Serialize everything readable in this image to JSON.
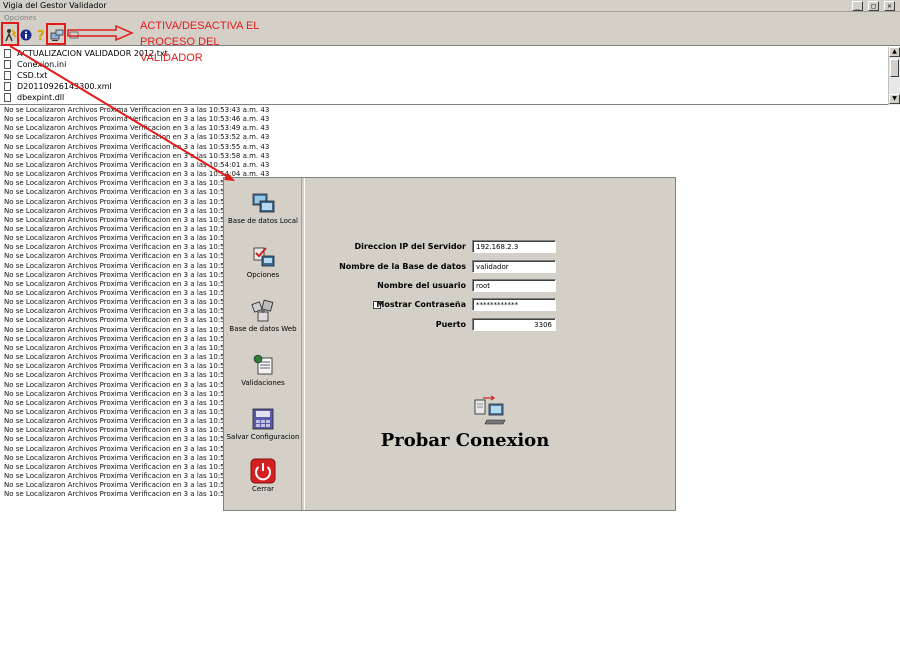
{
  "window": {
    "title": "Vigia del Gestor Validador",
    "min": "_",
    "max": "□",
    "close": "✕"
  },
  "menu": {
    "label": "Opciones"
  },
  "files": [
    "ACTUALIZACION VALIDADOR 2012.txt",
    "Conexion.ini",
    "CSD.txt",
    "D20110926143300.xml",
    "dbexpint.dll"
  ],
  "log_lines": [
    "No se Localizaron Archivos Proxima Verificacion en 3 a las 10:53:43 a.m.  43",
    "No se Localizaron Archivos Proxima Verificacion en 3 a las 10:53:46 a.m.  43",
    "No se Localizaron Archivos Proxima Verificacion en 3 a las 10:53:49 a.m.  43",
    "No se Localizaron Archivos Proxima Verificacion en 3 a las 10:53:52 a.m.  43",
    "No se Localizaron Archivos Proxima Verificacion en 3 a las 10:53:55 a.m.  43",
    "No se Localizaron Archivos Proxima Verificacion en 3 a las 10:53:58 a.m.  43",
    "No se Localizaron Archivos Proxima Verificacion en 3 a las 10:54:01 a.m.  43",
    "No se Localizaron Archivos Proxima Verificacion en 3 a las 10:54:04 a.m.  43",
    "No se Localizaron Archivos Proxima Verificacion en 3 a las 10:54:",
    "No se Localizaron Archivos Proxima Verificacion en 3 a las 10:54:",
    "No se Localizaron Archivos Proxima Verificacion en 3 a las 10:54:",
    "No se Localizaron Archivos Proxima Verificacion en 3 a las 10:54:",
    "No se Localizaron Archivos Proxima Verificacion en 3 a las 10:54:",
    "No se Localizaron Archivos Proxima Verificacion en 3 a las 10:54:",
    "No se Localizaron Archivos Proxima Verificacion en 3 a las 10:54:",
    "No se Localizaron Archivos Proxima Verificacion en 3 a las 10:54:",
    "No se Localizaron Archivos Proxima Verificacion en 3 a las 10:54:",
    "No se Localizaron Archivos Proxima Verificacion en 3 a las 10:54:",
    "No se Localizaron Archivos Proxima Verificacion en 3 a las 10:54:",
    "No se Localizaron Archivos Proxima Verificacion en 3 a las 10:54:",
    "No se Localizaron Archivos Proxima Verificacion en 3 a las 10:54:",
    "No se Localizaron Archivos Proxima Verificacion en 3 a las 10:54:",
    "No se Localizaron Archivos Proxima Verificacion en 3 a las 10:54:",
    "No se Localizaron Archivos Proxima Verificacion en 3 a las 10:54:",
    "No se Localizaron Archivos Proxima Verificacion en 3 a las 10:54:",
    "No se Localizaron Archivos Proxima Verificacion en 3 a las 10:55:",
    "No se Localizaron Archivos Proxima Verificacion en 3 a las 10:55:",
    "No se Localizaron Archivos Proxima Verificacion en 3 a las 10:55:",
    "No se Localizaron Archivos Proxima Verificacion en 3 a las 10:55:",
    "No se Localizaron Archivos Proxima Verificacion en 3 a las 10:55:",
    "No se Localizaron Archivos Proxima Verificacion en 3 a las 10:55:",
    "No se Localizaron Archivos Proxima Verificacion en 3 a las 10:55:",
    "No se Localizaron Archivos Proxima Verificacion en 3 a las 10:55:",
    "No se Localizaron Archivos Proxima Verificacion en 3 a las 10:55:",
    "No se Localizaron Archivos Proxima Verificacion en 3 a las 10:55:",
    "No se Localizaron Archivos Proxima Verificacion en 3 a las 10:55:",
    "No se Localizaron Archivos Proxima Verificacion en 3 a las 10:55:",
    "No se Localizaron Archivos Proxima Verificacion en 3 a las 10:55:",
    "No se Localizaron Archivos Proxima Verificacion en 3 a las 10:55:",
    "No se Localizaron Archivos Proxima Verificacion en 3 a las 10:55:",
    "No se Localizaron Archivos Proxima Verificacion en 3 a las 10:55:",
    "No se Localizaron Archivos Proxima Verificacion en 3 a las 10:55:",
    "No se Localizaron Archivos Proxima Verificacion en 3 a las 10:55:"
  ],
  "annotation": {
    "lines": [
      "ACTIVA/DESACTIVA EL",
      "PROCESO DEL",
      "VALIDADOR"
    ],
    "color": "#e21b1b"
  },
  "dialog": {
    "nav": [
      {
        "label": "Base de datos Local",
        "icon": "database-local-icon"
      },
      {
        "label": "Opciones",
        "icon": "options-icon"
      },
      {
        "label": "Base de datos Web",
        "icon": "database-web-icon"
      },
      {
        "label": "Validaciones",
        "icon": "validations-icon"
      },
      {
        "label": "Salvar Configuracion",
        "icon": "save-config-icon"
      },
      {
        "label": "Cerrar",
        "icon": "power-icon"
      }
    ],
    "fields": {
      "server_ip": {
        "label": "Direccion IP del Servidor",
        "value": "192.168.2.3"
      },
      "db_name": {
        "label": "Nombre de la Base de datos",
        "value": "validador"
      },
      "user": {
        "label": "Nombre del usuario",
        "value": "root"
      },
      "password": {
        "label": "Mostrar Contraseña",
        "value": "************",
        "show_checked": false
      },
      "port": {
        "label": "Puerto",
        "value": "3306"
      }
    },
    "test_button": {
      "label": "Probar Conexion"
    }
  }
}
